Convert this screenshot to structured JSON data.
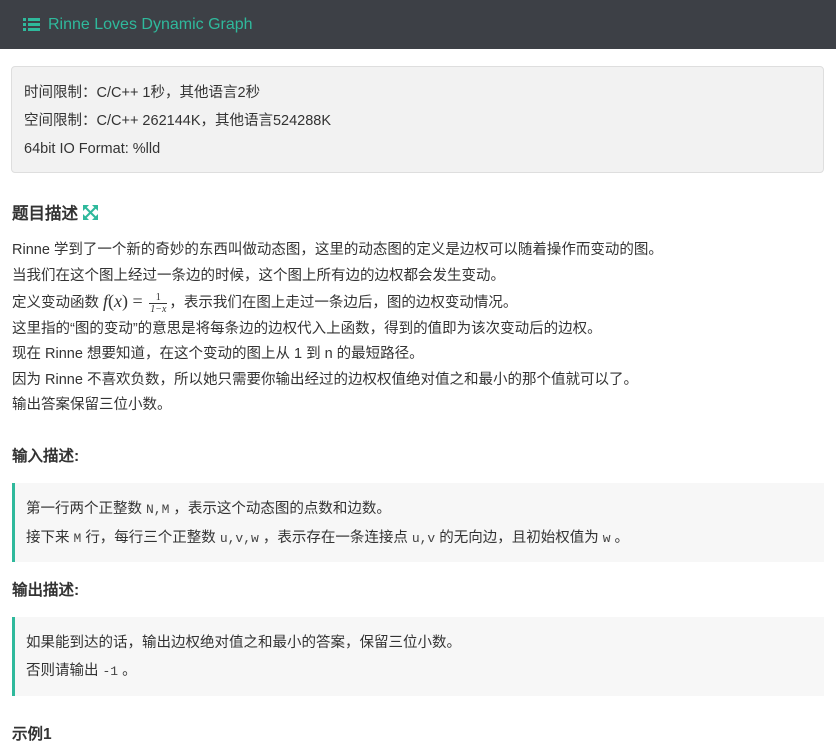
{
  "header": {
    "title": "Rinne Loves Dynamic Graph",
    "icon": "list-icon"
  },
  "limits": {
    "time": "时间限制：C/C++ 1秒，其他语言2秒",
    "space": "空间限制：C/C++ 262144K，其他语言524288K",
    "io": "64bit IO Format: %lld"
  },
  "description": {
    "heading": "题目描述",
    "line1": "Rinne 学到了一个新的奇妙的东西叫做动态图，这里的动态图的定义是边权可以随着操作而变动的图。",
    "line2": "当我们在这个图上经过一条边的时候，这个图上所有边的边权都会发生变动。",
    "line3_prefix": "定义变动函数",
    "formula_fx": "f",
    "formula_x": "x",
    "formula_num": "1",
    "formula_den": "1−x",
    "line3_suffix": "，表示我们在图上走过一条边后，图的边权变动情况。",
    "line4": "这里指的“图的变动”的意思是将每条边的边权代入上函数，得到的值即为该次变动后的边权。",
    "line5": "现在 Rinne 想要知道，在这个变动的图上从 1 到 n 的最短路径。",
    "line6": "因为 Rinne 不喜欢负数，所以她只需要你输出经过的边权权值绝对值之和最小的那个值就可以了。",
    "line7": "输出答案保留三位小数。"
  },
  "input": {
    "heading": "输入描述:",
    "l1_a": "第一行两个正整数",
    "l1_code": "N,M",
    "l1_b": "，表示这个动态图的点数和边数。",
    "l2_a": "接下来",
    "l2_code1": "M",
    "l2_b": "行，每行三个正整数",
    "l2_code2": "u,v,w",
    "l2_c": "，表示存在一条连接点",
    "l2_code3": "u,v",
    "l2_d": "的无向边，且初始权值为",
    "l2_code4": "w",
    "l2_e": "。"
  },
  "output": {
    "heading": "输出描述:",
    "l1": "如果能到达的话，输出边权绝对值之和最小的答案，保留三位小数。",
    "l2_a": "否则请输出",
    "l2_code": "-1",
    "l2_b": "。"
  },
  "example": {
    "heading": "示例1"
  },
  "colors": {
    "accent": "#2fb99c",
    "topbar": "#3d4046"
  }
}
